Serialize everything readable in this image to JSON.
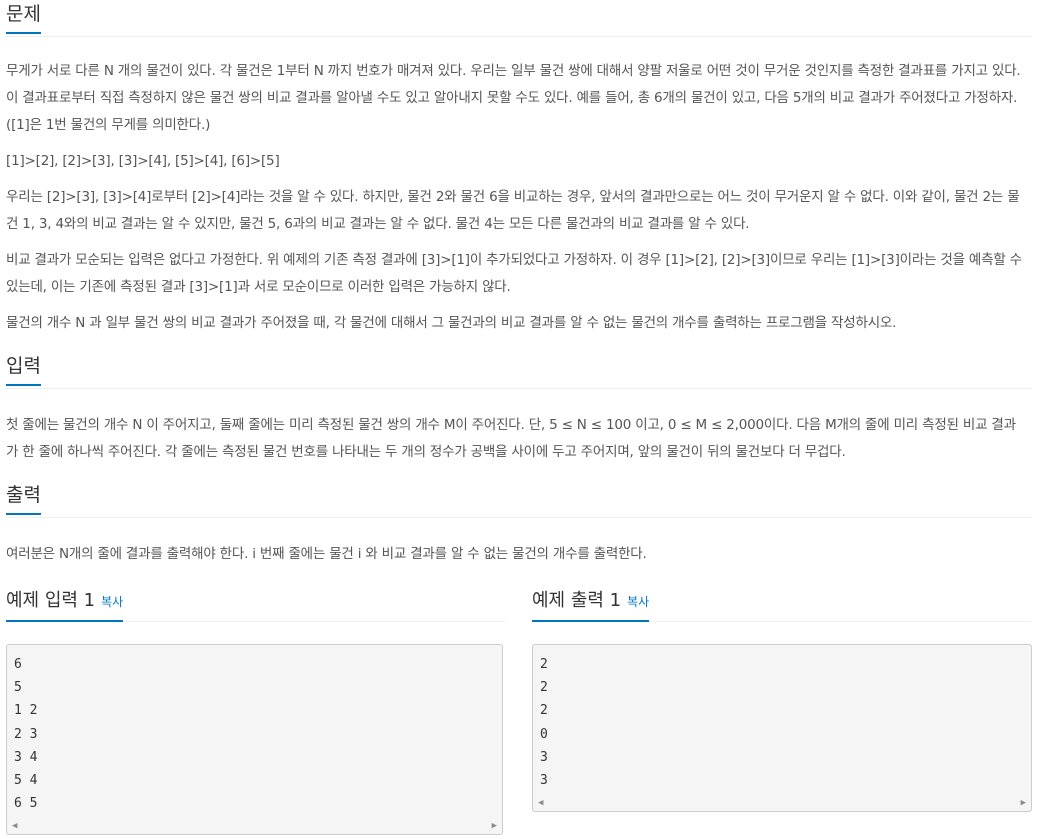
{
  "problem": {
    "title": "문제",
    "paragraphs": [
      "무게가 서로 다른 N 개의 물건이 있다. 각 물건은 1부터 N 까지 번호가 매겨져 있다. 우리는 일부 물건 쌍에 대해서 양팔 저울로 어떤 것이 무거운 것인지를 측정한 결과표를 가지고 있다. 이 결과표로부터 직접 측정하지 않은 물건 쌍의 비교 결과를 알아낼 수도 있고 알아내지 못할 수도 있다. 예를 들어, 총 6개의 물건이 있고, 다음 5개의 비교 결과가 주어졌다고 가정하자. ([1]은 1번 물건의 무게를 의미한다.)",
      "[1]>[2], [2]>[3], [3]>[4], [5]>[4], [6]>[5]",
      "우리는 [2]>[3], [3]>[4]로부터 [2]>[4]라는 것을 알 수 있다. 하지만, 물건 2와 물건 6을 비교하는 경우, 앞서의 결과만으로는 어느 것이 무거운지 알 수 없다. 이와 같이, 물건 2는 물건 1, 3, 4와의 비교 결과는 알 수 있지만, 물건 5, 6과의 비교 결과는 알 수 없다. 물건 4는 모든 다른 물건과의 비교 결과를 알 수 있다.",
      "비교 결과가 모순되는 입력은 없다고 가정한다. 위 예제의 기존 측정 결과에 [3]>[1]이 추가되었다고 가정하자. 이 경우 [1]>[2], [2]>[3]이므로 우리는 [1]>[3]이라는 것을 예측할 수 있는데, 이는 기존에 측정된 결과 [3]>[1]과 서로 모순이므로 이러한 입력은 가능하지 않다.",
      "물건의 개수 N 과 일부 물건 쌍의 비교 결과가 주어졌을 때, 각 물건에 대해서 그 물건과의 비교 결과를 알 수 없는 물건의 개수를 출력하는 프로그램을 작성하시오."
    ]
  },
  "input": {
    "title": "입력",
    "paragraphs": [
      "첫 줄에는 물건의 개수 N 이 주어지고, 둘째 줄에는 미리 측정된 물건 쌍의 개수 M이 주어진다. 단, 5 ≤ N ≤ 100 이고, 0 ≤ M ≤ 2,000이다. 다음 M개의 줄에 미리 측정된 비교 결과가 한 줄에 하나씩 주어진다. 각 줄에는 측정된 물건 번호를 나타내는 두 개의 정수가 공백을 사이에 두고 주어지며, 앞의 물건이 뒤의 물건보다 더 무겁다."
    ]
  },
  "output": {
    "title": "출력",
    "paragraphs": [
      "여러분은 N개의 줄에 결과를 출력해야 한다. i 번째 줄에는 물건 i 와 비교 결과를 알 수 없는 물건의 개수를 출력한다."
    ]
  },
  "sample_input": {
    "title": "예제 입력 1",
    "copy_label": "복사",
    "lines": [
      "6",
      "5",
      "1 2",
      "2 3",
      "3 4",
      "5 4",
      "6 5"
    ]
  },
  "sample_output": {
    "title": "예제 출력 1",
    "copy_label": "복사",
    "lines": [
      "2",
      "2",
      "2",
      "0",
      "3",
      "3"
    ]
  },
  "icons": {
    "scroll_left": "triangle-left-icon",
    "scroll_right": "triangle-right-icon"
  }
}
